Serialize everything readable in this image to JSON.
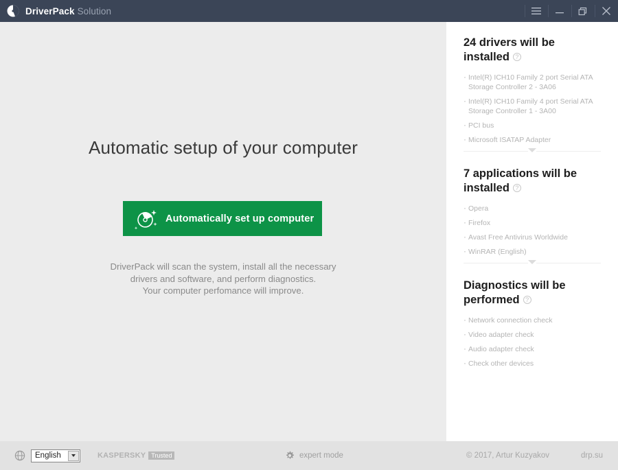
{
  "titlebar": {
    "app_name": "DriverPack",
    "app_suffix": "Solution",
    "logo_icon": "driverpack-logo-icon",
    "buttons": [
      {
        "name": "menu-button",
        "icon": "hamburger-icon"
      },
      {
        "name": "minimize-button",
        "icon": "minimize-icon"
      },
      {
        "name": "restore-button",
        "icon": "restore-icon"
      },
      {
        "name": "close-button",
        "icon": "close-icon"
      }
    ],
    "bg_color": "#3b4557"
  },
  "main": {
    "headline": "Automatic setup of your computer",
    "cta_label": "Automatically set up computer",
    "cta_icon": "disc-sparkle-icon",
    "cta_color": "#0d9347",
    "description": [
      "DriverPack will scan the system, install all the necessary",
      "drivers and software, and perform diagnostics.",
      "Your computer perfomance will improve."
    ]
  },
  "panel": {
    "sections": [
      {
        "title": "24 drivers will be installed",
        "help_icon": "help-circle-icon",
        "items": [
          "Intel(R) ICH10 Family 2 port Serial ATA Storage Controller 2 - 3A06",
          "Intel(R) ICH10 Family 4 port Serial ATA Storage Controller 1 - 3A00",
          "PCI bus",
          "Microsoft ISATAP Adapter"
        ],
        "expand_icon": "chevron-down-icon"
      },
      {
        "title": "7 applications will be installed",
        "help_icon": "help-circle-icon",
        "items": [
          "Opera",
          "Firefox",
          "Avast Free Antivirus Worldwide",
          "WinRAR (English)"
        ],
        "expand_icon": "chevron-down-icon"
      },
      {
        "title": "Diagnostics will be performed",
        "help_icon": "help-circle-icon",
        "items": [
          "Network connection check",
          "Video adapter check",
          "Audio adapter check",
          "Check other devices"
        ],
        "expand_icon": null
      }
    ]
  },
  "footer": {
    "globe_icon": "globe-icon",
    "language": "English",
    "kaspersky_label": "KASPERSKY",
    "kaspersky_badge": "Trusted",
    "expert_mode_label": "expert mode",
    "expert_icon": "gear-icon",
    "copyright": "© 2017, Artur Kuzyakov",
    "site": "drp.su"
  }
}
